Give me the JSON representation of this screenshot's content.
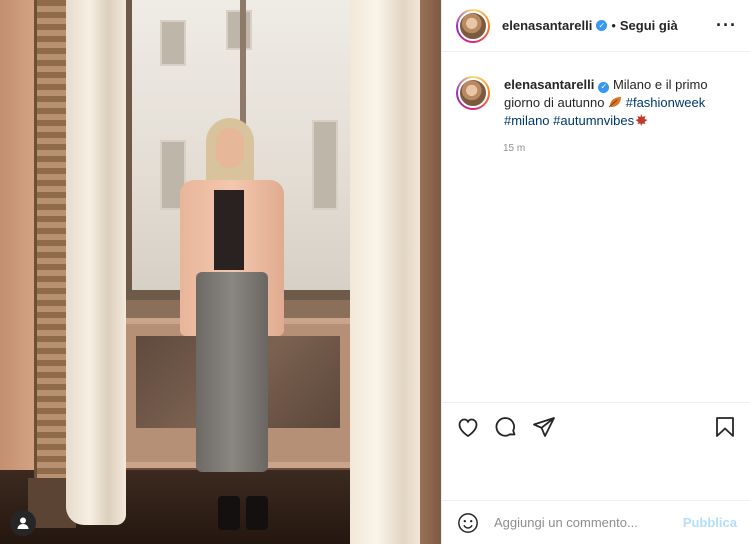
{
  "post": {
    "image_alt": "Elena Santarelli standing in front of a window",
    "header": {
      "username": "elenasantarelli",
      "separator": "•",
      "follow_label": "Segui già",
      "more_icon": "more-horizontal-icon"
    },
    "caption": {
      "username": "elenasantarelli",
      "text_part1": "Milano e il primo giorno di autunno",
      "hashtags": [
        "#fashionweek",
        "#milano",
        "#autumnvibes"
      ],
      "emoji": [
        "fallen-leaf-emoji",
        "maple-leaf-emoji"
      ]
    },
    "timestamp": "15 m",
    "actions": {
      "like_icon": "heart-icon",
      "comment_icon": "comment-icon",
      "share_icon": "share-icon",
      "save_icon": "bookmark-icon"
    },
    "add_comment": {
      "placeholder": "Aggiungi un commento...",
      "publish_label": "Pubblica"
    }
  },
  "colors": {
    "verified": "#3897f0",
    "hashtag": "#00376b",
    "publish_disabled": "#b2dffc",
    "muted_text": "#8e8e8e"
  }
}
